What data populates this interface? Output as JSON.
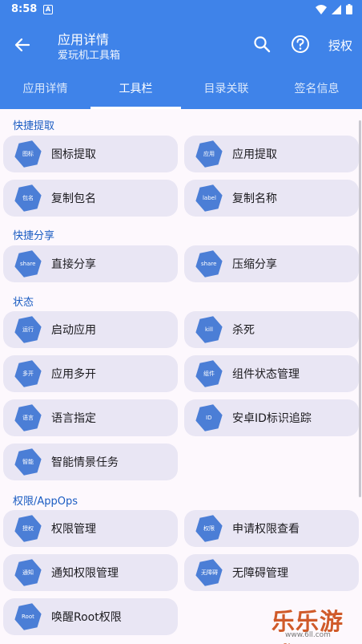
{
  "status_bar": {
    "time": "8:58",
    "notif_letter": "A"
  },
  "app_bar": {
    "title": "应用详情",
    "subtitle": "爱玩机工具箱",
    "action_label": "授权"
  },
  "tabs": [
    "应用详情",
    "工具栏",
    "目录关联",
    "签名信息"
  ],
  "active_tab": 1,
  "sections": [
    {
      "title": "快捷提取",
      "items": [
        {
          "icon_text": "图标",
          "label": "图标提取"
        },
        {
          "icon_text": "应用",
          "label": "应用提取"
        },
        {
          "icon_text": "包名",
          "label": "复制包名"
        },
        {
          "icon_text": "label",
          "label": "复制名称"
        }
      ]
    },
    {
      "title": "快捷分享",
      "items": [
        {
          "icon_text": "share",
          "label": "直接分享"
        },
        {
          "icon_text": "share",
          "label": "压缩分享"
        }
      ]
    },
    {
      "title": "状态",
      "items": [
        {
          "icon_text": "运行",
          "label": "启动应用"
        },
        {
          "icon_text": "kill",
          "label": "杀死"
        },
        {
          "icon_text": "多开",
          "label": "应用多开"
        },
        {
          "icon_text": "组件",
          "label": "组件状态管理"
        },
        {
          "icon_text": "语言",
          "label": "语言指定"
        },
        {
          "icon_text": "ID",
          "label": "安卓ID标识追踪"
        },
        {
          "icon_text": "智能",
          "label": "智能情景任务"
        }
      ]
    },
    {
      "title": "权限/AppOps",
      "items": [
        {
          "icon_text": "授权",
          "label": "权限管理"
        },
        {
          "icon_text": "权限",
          "label": "申请权限查看"
        },
        {
          "icon_text": "通知",
          "label": "通知权限管理"
        },
        {
          "icon_text": "无障碍",
          "label": "无障碍管理"
        },
        {
          "icon_text": "Root",
          "label": "唤醒Root权限"
        }
      ]
    }
  ],
  "watermark": {
    "brand": "乐乐游戏",
    "url": "www.6ll.com"
  }
}
